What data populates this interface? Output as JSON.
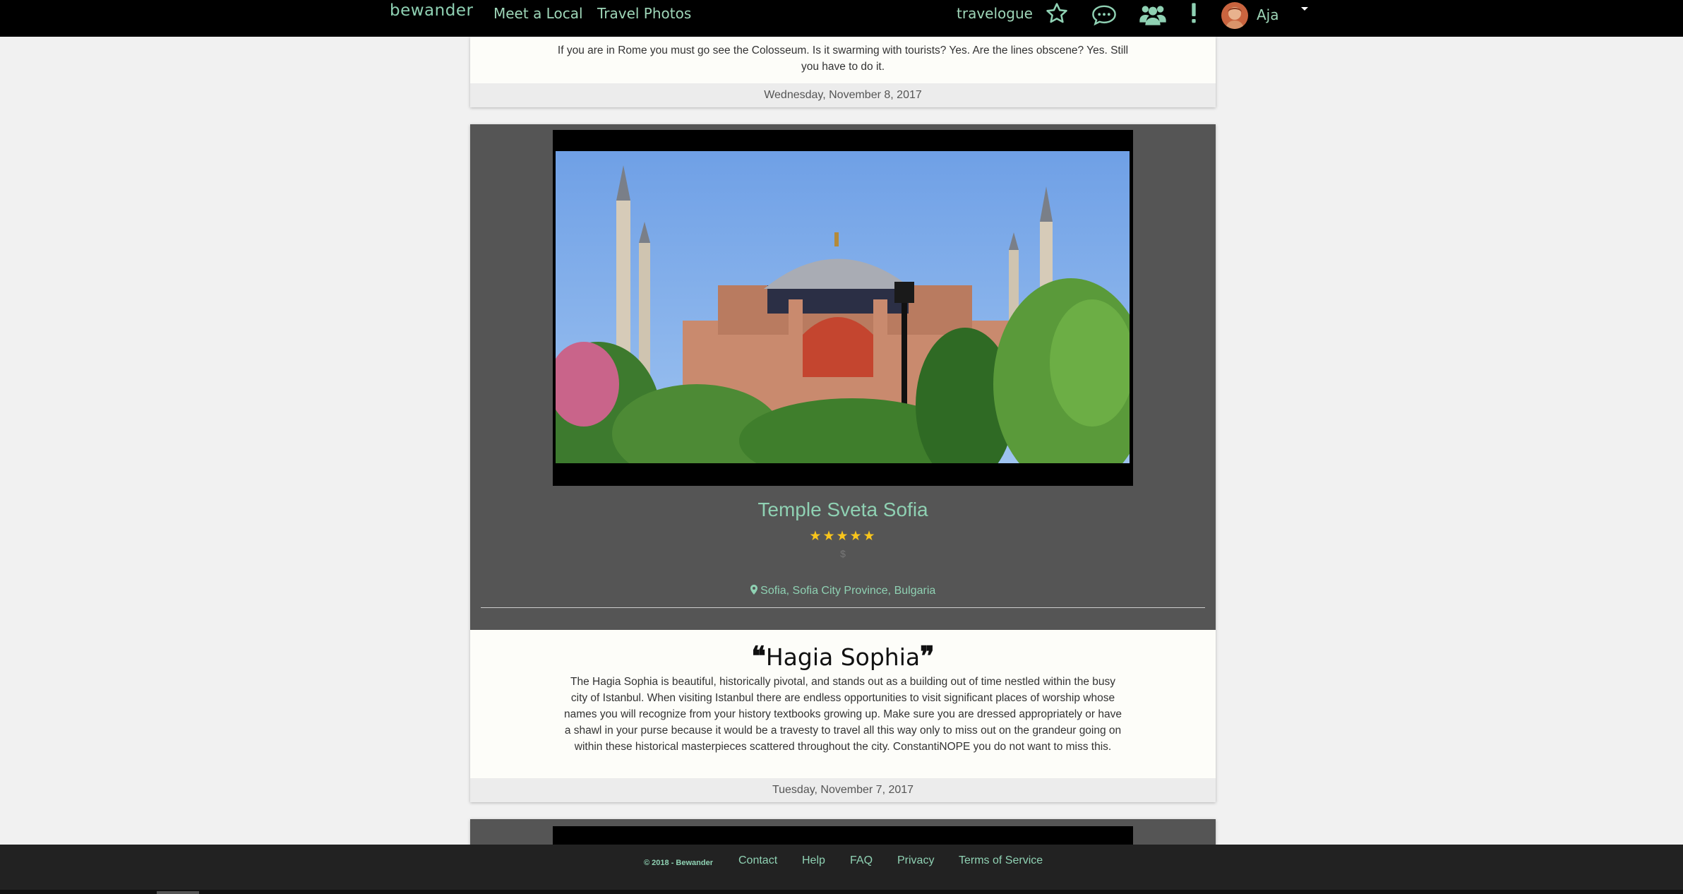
{
  "nav": {
    "brand": "bewander",
    "links": [
      "Meet a Local",
      "Travel Photos"
    ],
    "travelogue": "travelogue",
    "user_name": "Aja",
    "icons": [
      "star-icon",
      "chat-icon",
      "group-icon",
      "notification-icon"
    ]
  },
  "feed": {
    "prev_card": {
      "text": "If you are in Rome you must go see the Colosseum. Is it swarming with tourists? Yes. Are the lines obscene? Yes. Still you have to do it.",
      "date": "Wednesday, November 8, 2017"
    },
    "card": {
      "place_title": "Temple Sveta Sofia",
      "stars": "★★★★★",
      "price": "$",
      "location": "Sofia, Sofia City Province, Bulgaria",
      "review_title": "Hagia Sophia",
      "review_text": "The Hagia Sophia is beautiful, historically pivotal, and stands out as a building out of time nestled within the busy city of Istanbul. When visiting Istanbul there are endless opportunities to visit significant places of worship whose names you will recognize from your history textbooks growing up. Make sure you are dressed appropriately or have a shawl in your purse because it would be a travesty to travel all this way only to miss out on the grandeur going on within these historical masterpieces scattered throughout the city. ConstantiNOPE you do not want to miss this.",
      "date": "Tuesday, November 7, 2017",
      "rating": 5
    }
  },
  "footer": {
    "copyright": "© 2018 - Bewander",
    "links": [
      "Contact",
      "Help",
      "FAQ",
      "Privacy",
      "Terms of Service"
    ]
  },
  "colors": {
    "accent": "#8fd1b3",
    "star": "#f8c51c",
    "card_dark": "#555555",
    "navbar": "#000000"
  }
}
